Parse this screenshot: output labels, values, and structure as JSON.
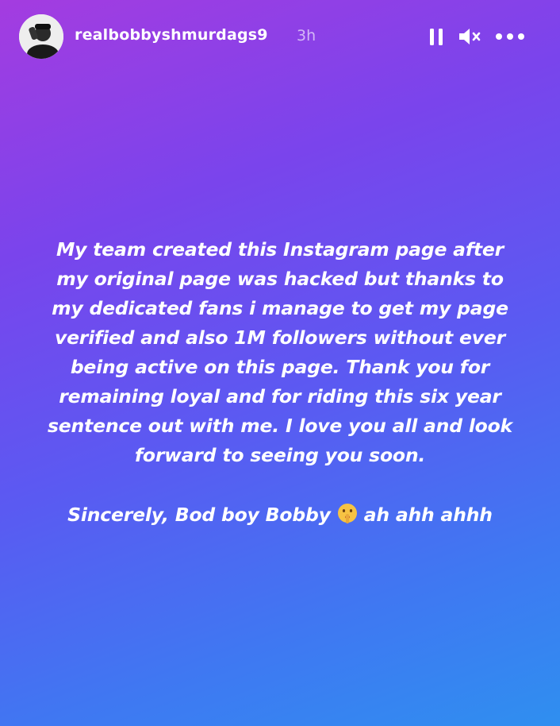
{
  "header": {
    "username": "realbobbyshmurdags9",
    "timestamp": "3h",
    "avatar_icon": "avatar-profile-photo",
    "controls": [
      {
        "name": "pause",
        "icon": "pause-icon"
      },
      {
        "name": "mute",
        "icon": "muted-speaker-icon"
      },
      {
        "name": "more",
        "icon": "more-dots-icon"
      }
    ]
  },
  "story": {
    "message": "My team created this Instagram page after\nmy original page was hacked but thanks to\nmy dedicated fans i manage to get my page\nverified and also 1M followers without ever\nbeing active on this page. Thank you for\nremaining loyal and for riding this six year\nsentence out with me. I love you all and look\nforward to seeing you soon.",
    "signoff_before": "Sincerely, Bod boy Bobby",
    "signoff_emoji": "shushing-face-emoji",
    "signoff_after": "ah ahh ahhh"
  },
  "colors": {
    "gradient_top": "#a43ce0",
    "gradient_bottom": "#2f8ff0",
    "text": "#ffffff"
  }
}
